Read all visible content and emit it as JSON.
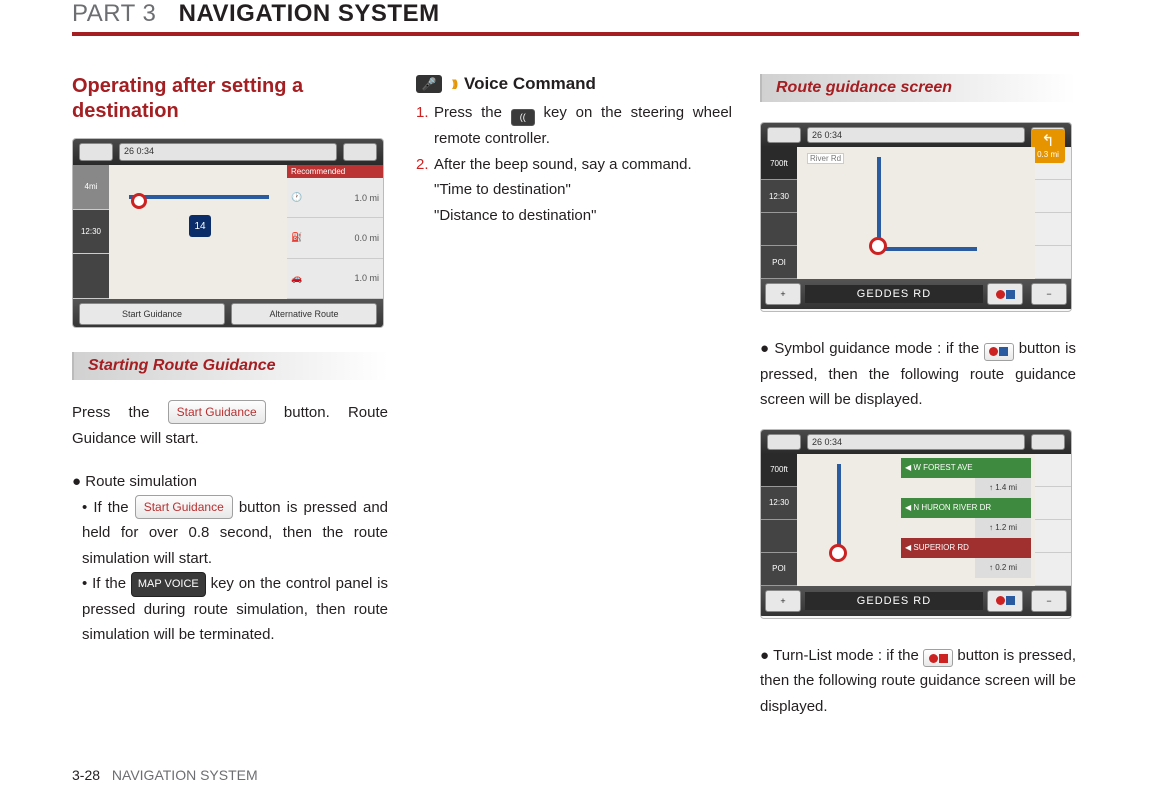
{
  "header": {
    "part": "PART 3",
    "title": "NAVIGATION SYSTEM"
  },
  "col1": {
    "heading": "Operating after setting a destination",
    "screenshot1": {
      "clock": "26  0:34",
      "shield": "14",
      "recommended": "Recommended",
      "row1_val": "1.0",
      "row1_unit": "mi",
      "row2_val": "0.0",
      "row2_unit": "mi",
      "row3_val": "1.0",
      "row3_unit": "mi",
      "btn1": "Start Guidance",
      "btn2": "Alternative Route"
    },
    "subsection": "Starting Route Guidance",
    "para1_a": "Press the ",
    "para1_btn": "Start Guidance",
    "para1_b": " button. Route Guidance will start.",
    "bullet1": "Route simulation",
    "sub1_a": "If the ",
    "sub1_btn": "Start Guidance",
    "sub1_b": " button is pressed and held for over 0.8  second, then the route simulation will start.",
    "sub2_a": "If the ",
    "sub2_btn": "MAP VOICE",
    "sub2_b": " key on the control panel is pressed during route simulation, then route simulation will be terminated."
  },
  "col2": {
    "voice_heading": "Voice Command",
    "step1_a": "Press the ",
    "step1_key": "⇠",
    "step1_b": " key on the steering wheel remote controller.",
    "step2": "After the beep sound, say a command.",
    "quote1": "\"Time to destination\"",
    "quote2": "\"Distance to destination\""
  },
  "col3": {
    "subsection": "Route guidance screen",
    "screenshot2": {
      "clock": "26  0:34",
      "dist1": "700ft",
      "time": "12:30",
      "poi": "POI",
      "road": "GEDDES RD",
      "turn_dist": "0.3 mi",
      "label": "River Rd"
    },
    "bullet1_a": "Symbol guidance mode : if the ",
    "bullet1_b": " button is pressed, then the following route guidance screen will be displayed.",
    "screenshot3": {
      "clock": "26  0:34",
      "dist1": "700ft",
      "time": "12:30",
      "poi": "POI",
      "road": "GEDDES RD",
      "list": [
        {
          "name": "W FOREST AVE",
          "color": "green",
          "dist": "↑  1.4 mi"
        },
        {
          "name": "N HURON RIVER DR",
          "color": "green",
          "dist": "↑  1.2 mi"
        },
        {
          "name": "SUPERIOR RD",
          "color": "red",
          "dist": "↑  0.2 mi"
        }
      ]
    },
    "bullet2_a": "Turn-List mode : if the ",
    "bullet2_b": " button is pressed, then the following route guidance screen will be displayed."
  },
  "footer": {
    "page": "3-28",
    "section": "NAVIGATION SYSTEM"
  }
}
